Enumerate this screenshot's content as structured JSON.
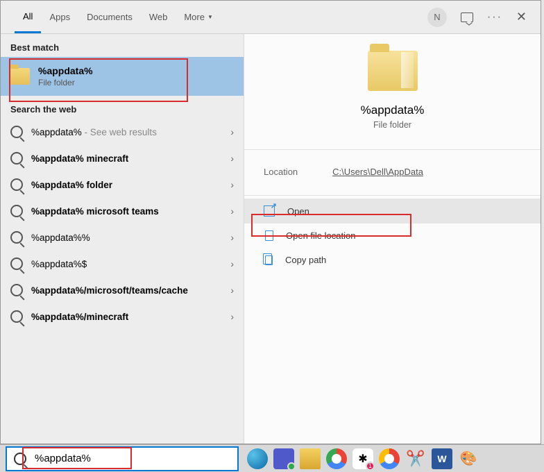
{
  "tabs": {
    "all": "All",
    "apps": "Apps",
    "documents": "Documents",
    "web": "Web",
    "more": "More"
  },
  "user_initial": "N",
  "sections": {
    "best_match": "Best match",
    "search_web": "Search the web"
  },
  "best_match": {
    "title": "%appdata%",
    "subtitle": "File folder"
  },
  "web_results": [
    {
      "text": "%appdata%",
      "hint": " - See web results",
      "bold": false
    },
    {
      "text": "%appdata% minecraft",
      "hint": "",
      "bold": true
    },
    {
      "text": "%appdata% folder",
      "hint": "",
      "bold": true
    },
    {
      "text": "%appdata% microsoft teams",
      "hint": "",
      "bold": true
    },
    {
      "text": "%appdata%%",
      "hint": "",
      "bold": false
    },
    {
      "text": "%appdata%$",
      "hint": "",
      "bold": false
    },
    {
      "text": "%appdata%/microsoft/teams/cache",
      "hint": "",
      "bold": true
    },
    {
      "text": "%appdata%/minecraft",
      "hint": "",
      "bold": true
    }
  ],
  "preview": {
    "title": "%appdata%",
    "subtitle": "File folder",
    "location_label": "Location",
    "location_value": "C:\\Users\\Dell\\AppData"
  },
  "actions": {
    "open": "Open",
    "open_location": "Open file location",
    "copy_path": "Copy path"
  },
  "search_value": "%appdata%"
}
